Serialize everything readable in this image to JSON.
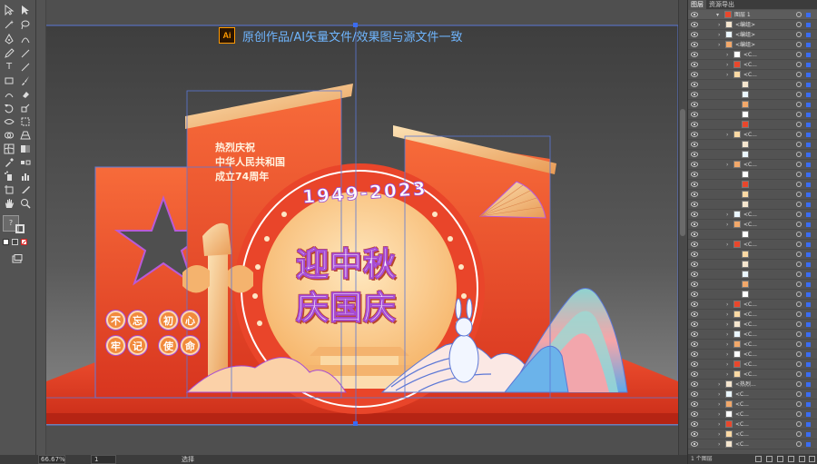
{
  "banner": {
    "logo": "Ai",
    "text": "原创作品/AI矢量文件/效果图与源文件一致"
  },
  "artwork": {
    "year_range": "1949-2023",
    "main_line1": "迎中秋",
    "main_line2": "庆国庆",
    "side_lines": [
      "热烈庆祝",
      "中华人民共和国",
      "成立74周年"
    ],
    "seal_row1": [
      "不",
      "忘",
      "初",
      "心"
    ],
    "seal_row2": [
      "牢",
      "记",
      "使",
      "命"
    ],
    "colors": {
      "accent_red": "#e8472c",
      "accent_orange": "#f7a35a",
      "gold": "#f7d9a0",
      "selection": "#3a6cf2"
    }
  },
  "status": {
    "zoom": "66.67%",
    "page": "1",
    "tool": "选择"
  },
  "panel": {
    "tab_layers": "图层",
    "tab_other": "资源导出",
    "top_layer": "图层 1",
    "footer": "1 个图层",
    "rows": [
      {
        "label": "<编组>",
        "indent": 1
      },
      {
        "label": "<编组>",
        "indent": 1
      },
      {
        "label": "<编组>",
        "indent": 1
      },
      {
        "label": "<C...",
        "indent": 2
      },
      {
        "label": "<C...",
        "indent": 2
      },
      {
        "label": "<C...",
        "indent": 2
      },
      {
        "label": "",
        "indent": 3
      },
      {
        "label": "",
        "indent": 3
      },
      {
        "label": "",
        "indent": 3
      },
      {
        "label": "",
        "indent": 3
      },
      {
        "label": "",
        "indent": 3
      },
      {
        "label": "<C...",
        "indent": 2
      },
      {
        "label": "",
        "indent": 3
      },
      {
        "label": "",
        "indent": 3
      },
      {
        "label": "<C...",
        "indent": 2
      },
      {
        "label": "",
        "indent": 3
      },
      {
        "label": "",
        "indent": 3
      },
      {
        "label": "",
        "indent": 3
      },
      {
        "label": "",
        "indent": 3
      },
      {
        "label": "<C...",
        "indent": 2
      },
      {
        "label": "<C...",
        "indent": 2
      },
      {
        "label": "",
        "indent": 3
      },
      {
        "label": "<C...",
        "indent": 2
      },
      {
        "label": "",
        "indent": 3
      },
      {
        "label": "",
        "indent": 3
      },
      {
        "label": "",
        "indent": 3
      },
      {
        "label": "",
        "indent": 3
      },
      {
        "label": "",
        "indent": 3
      },
      {
        "label": "<C...",
        "indent": 2
      },
      {
        "label": "<C...",
        "indent": 2
      },
      {
        "label": "<C...",
        "indent": 2
      },
      {
        "label": "<C...",
        "indent": 2
      },
      {
        "label": "<C...",
        "indent": 2
      },
      {
        "label": "<C...",
        "indent": 2
      },
      {
        "label": "<C...",
        "indent": 2
      },
      {
        "label": "<C...",
        "indent": 2
      },
      {
        "label": "<热烈...",
        "indent": 1
      },
      {
        "label": "<C...",
        "indent": 1
      },
      {
        "label": "<C...",
        "indent": 1
      },
      {
        "label": "<C...",
        "indent": 1
      },
      {
        "label": "<C...",
        "indent": 1
      },
      {
        "label": "<C...",
        "indent": 1
      },
      {
        "label": "<C...",
        "indent": 1
      }
    ]
  }
}
